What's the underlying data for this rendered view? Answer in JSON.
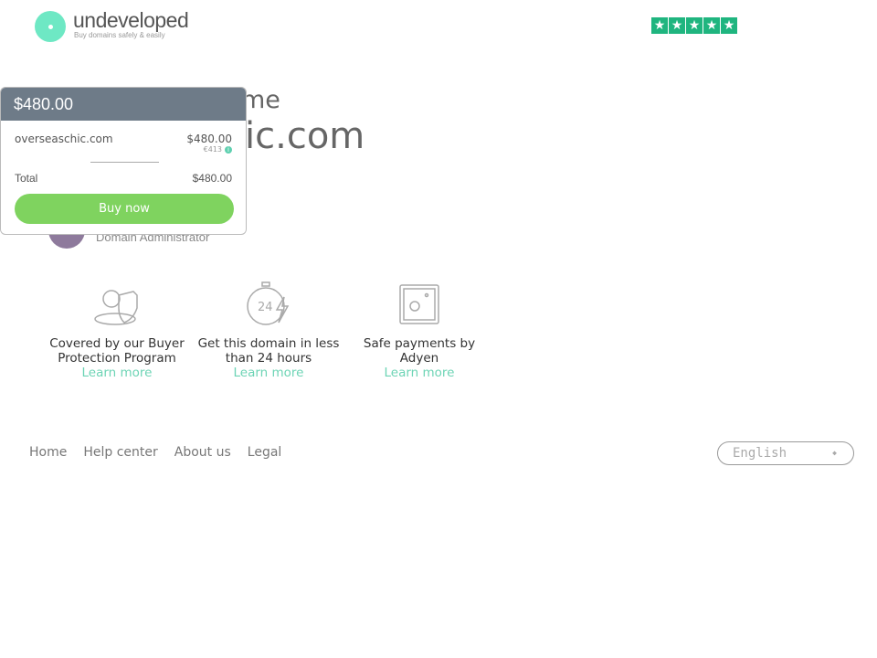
{
  "header": {
    "logo_text": "undeveloped",
    "tagline": "Buy domains safely & easily",
    "rating_stars": 5,
    "rating_color": "#1fb57f"
  },
  "main": {
    "title_fragment": "me",
    "domain_fragment": "ic.com",
    "admin_role": "Domain Administrator"
  },
  "popup": {
    "header_price": "$480.00",
    "domain": "overseaschic.com",
    "price": "$480.00",
    "price_eur": "€413",
    "info_icon": "info-icon",
    "total_label": "Total",
    "total_value": "$480.00",
    "buy_label": "Buy now",
    "buy_color": "#7fd35f"
  },
  "features": [
    {
      "icon": "shield-person-icon",
      "text": "Covered by our Buyer Protection Program",
      "link": "Learn more"
    },
    {
      "icon": "stopwatch-24-icon",
      "text": "Get this domain in less than 24 hours",
      "link": "Learn more"
    },
    {
      "icon": "safe-icon",
      "text": "Safe payments by Adyen",
      "link": "Learn more"
    }
  ],
  "footer": {
    "links": [
      "Home",
      "Help center",
      "About us",
      "Legal"
    ],
    "language": "English"
  }
}
